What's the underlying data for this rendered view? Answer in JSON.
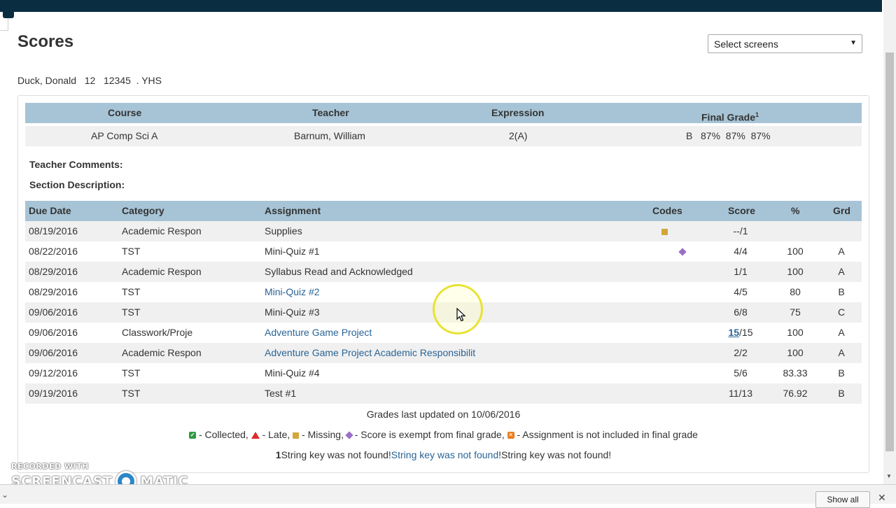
{
  "page": {
    "title": "Scores"
  },
  "screens_select": {
    "value": "Select screens"
  },
  "student": {
    "name": "Duck, Donald",
    "grade": "12",
    "id": "12345",
    "school": ". YHS"
  },
  "course_table": {
    "headers": {
      "course": "Course",
      "teacher": "Teacher",
      "expression": "Expression",
      "final_grade": "Final Grade",
      "final_grade_sup": "1"
    },
    "row": {
      "course": "AP Comp Sci A",
      "teacher": "Barnum, William",
      "expression": "2(A)",
      "final_grade": "B   87%  87%  87%"
    }
  },
  "labels": {
    "teacher_comments": "Teacher Comments:",
    "section_description": "Section Description:"
  },
  "assignments": {
    "headers": {
      "due_date": "Due Date",
      "category": "Category",
      "assignment": "Assignment",
      "codes": "Codes",
      "score": "Score",
      "pct": "%",
      "grd": "Grd"
    },
    "rows": [
      {
        "due": "08/19/2016",
        "category": "Academic Respon",
        "assignment": "Supplies",
        "code": "missing",
        "score": "--/1",
        "score_link": "",
        "pct": "",
        "grd": "",
        "link": false
      },
      {
        "due": "08/22/2016",
        "category": "TST",
        "assignment": "Mini-Quiz #1",
        "code": "exempt",
        "score": "4/4",
        "score_link": "",
        "pct": "100",
        "grd": "A",
        "link": false
      },
      {
        "due": "08/29/2016",
        "category": "Academic Respon",
        "assignment": "Syllabus Read and Acknowledged",
        "code": "",
        "score": "1/1",
        "score_link": "",
        "pct": "100",
        "grd": "A",
        "link": false
      },
      {
        "due": "08/29/2016",
        "category": "TST",
        "assignment": "Mini-Quiz #2",
        "code": "",
        "score": "4/5",
        "score_link": "",
        "pct": "80",
        "grd": "B",
        "link": true
      },
      {
        "due": "09/06/2016",
        "category": "TST",
        "assignment": "Mini-Quiz #3",
        "code": "",
        "score": "6/8",
        "score_link": "",
        "pct": "75",
        "grd": "C",
        "link": false
      },
      {
        "due": "09/06/2016",
        "category": "Classwork/Proje",
        "assignment": "Adventure Game Project",
        "code": "",
        "score": "/15",
        "score_link": "15",
        "pct": "100",
        "grd": "A",
        "link": true
      },
      {
        "due": "09/06/2016",
        "category": "Academic Respon",
        "assignment": "Adventure Game Project Academic Responsibilit",
        "code": "",
        "score": "2/2",
        "score_link": "",
        "pct": "100",
        "grd": "A",
        "link": true
      },
      {
        "due": "09/12/2016",
        "category": "TST",
        "assignment": "Mini-Quiz #4",
        "code": "",
        "score": "5/6",
        "score_link": "",
        "pct": "83.33",
        "grd": "B",
        "link": false
      },
      {
        "due": "09/19/2016",
        "category": "TST",
        "assignment": "Test #1",
        "code": "",
        "score": "11/13",
        "score_link": "",
        "pct": "76.92",
        "grd": "B",
        "link": false
      }
    ]
  },
  "updated": "Grades last updated on 10/06/2016",
  "legend": {
    "collected": " - Collected,",
    "late": " - Late,",
    "missing": " - Missing,",
    "exempt": " - Score is exempt from final grade,",
    "not_included": " - Assignment is not included in final grade"
  },
  "footnote": {
    "num": "1",
    "part1": "String key was not found!",
    "part2": "String key was not found",
    "part3": "!String key was not found!"
  },
  "watermark": {
    "line1": "RECORDED WITH",
    "left": "SCREENCAST",
    "right": "MATIC"
  },
  "downloads_bar": {
    "show_all": "Show all",
    "close": "✕"
  },
  "colors": {
    "topbar": "#0b2d42",
    "header_bg": "#a7c4d6",
    "link": "#2a6496",
    "missing": "#d4a537",
    "exempt": "#9b6fc6",
    "late": "#e02a2a",
    "collected": "#2e9a44"
  },
  "icons": {
    "missing": "square-missing-icon",
    "exempt": "diamond-exempt-icon",
    "late": "triangle-late-icon",
    "collected": "check-collected-icon",
    "not_included": "x-square-icon"
  }
}
